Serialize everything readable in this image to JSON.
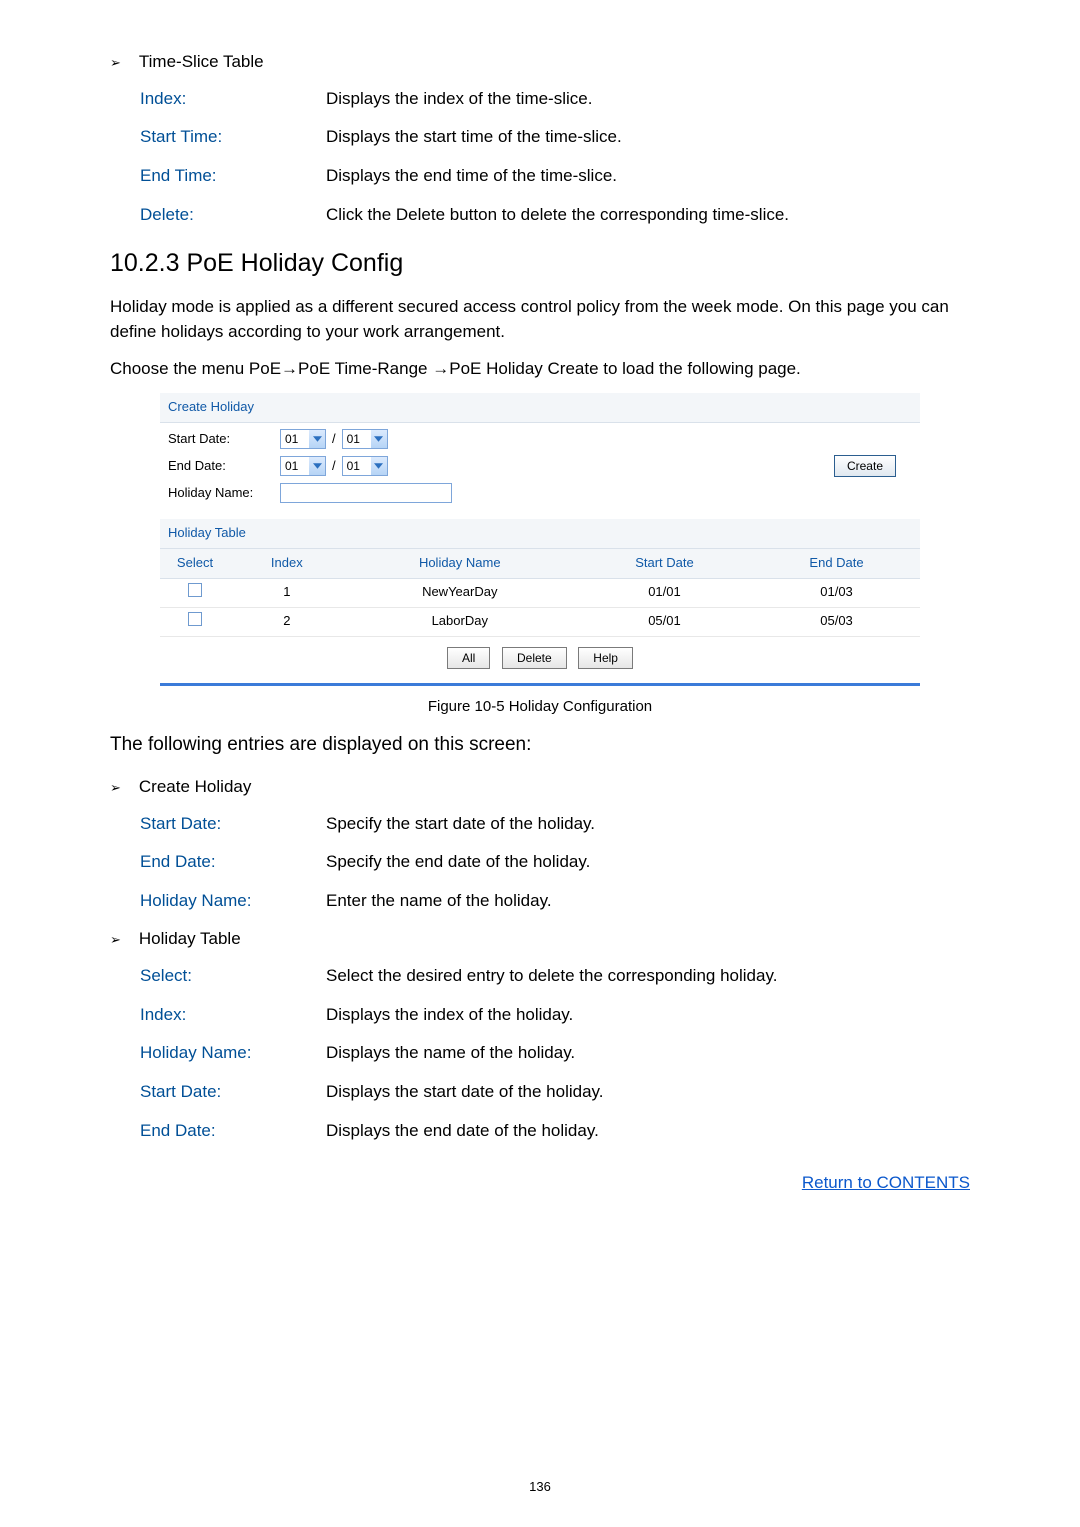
{
  "timeSliceTable": {
    "title": "Time-Slice Table",
    "items": [
      {
        "term": "Index:",
        "def": "Displays the index of the time-slice."
      },
      {
        "term": "Start Time:",
        "def": "Displays the start time of the time-slice."
      },
      {
        "term": "End Time:",
        "def": "Displays the end time of the time-slice."
      },
      {
        "term": "Delete:",
        "def": "Click the Delete button to delete the corresponding time-slice."
      }
    ]
  },
  "sectionTitle": "10.2.3  PoE Holiday Config",
  "para1": "Holiday mode is applied as a different secured access control policy from the week mode. On this page you can define holidays according to your work arrangement.",
  "para2": "Choose the menu PoE→PoE Time-Range →PoE Holiday Create  to load the following page.",
  "figure": {
    "createHoliday": {
      "header": "Create Holiday",
      "startDateLabel": "Start Date:",
      "endDateLabel": "End Date:",
      "holidayNameLabel": "Holiday Name:",
      "startMonth": "01",
      "startDay": "01",
      "endMonth": "01",
      "endDay": "01",
      "holidayName": "",
      "createLabel": "Create"
    },
    "holidayTable": {
      "header": "Holiday Table",
      "columns": [
        "Select",
        "Index",
        "Holiday Name",
        "Start Date",
        "End Date"
      ],
      "rows": [
        {
          "index": "1",
          "name": "NewYearDay",
          "start": "01/01",
          "end": "01/03"
        },
        {
          "index": "2",
          "name": "LaborDay",
          "start": "05/01",
          "end": "05/03"
        }
      ],
      "buttons": [
        "All",
        "Delete",
        "Help"
      ]
    }
  },
  "figCaption": "Figure 10-5 Holiday Configuration",
  "lead": "The following entries are displayed on this screen:",
  "createHolidaySection": {
    "title": "Create Holiday",
    "items": [
      {
        "term": "Start Date:",
        "def": "Specify the start date of the holiday."
      },
      {
        "term": "End Date:",
        "def": "Specify the end date of the holiday."
      },
      {
        "term": "Holiday Name:",
        "def": "Enter the name of the holiday."
      }
    ]
  },
  "holidayTableSection": {
    "title": "Holiday Table",
    "items": [
      {
        "term": "Select:",
        "def": "Select the desired entry to delete the corresponding holiday."
      },
      {
        "term": "Index:",
        "def": "Displays the index of the holiday."
      },
      {
        "term": "Holiday Name:",
        "def": "Displays the name of the holiday."
      },
      {
        "term": "Start Date:",
        "def": "Displays the start date of the holiday."
      },
      {
        "term": "End Date:",
        "def": "Displays the end date of the holiday."
      }
    ]
  },
  "returnLink": "Return to CONTENTS",
  "pageNum": "136"
}
